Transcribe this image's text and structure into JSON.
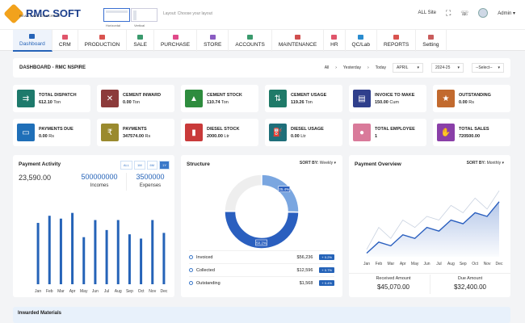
{
  "header": {
    "logo": "RMC SOFT",
    "logo_sub": "READY MIX CONCRETE",
    "layout_options": [
      "Horizontal",
      "Vertical"
    ],
    "layout_hint": "Layout: Choose your layout",
    "site": "ALL Site",
    "user": "Admin"
  },
  "menu": [
    {
      "label": "Dashboard",
      "color": "#2563b8"
    },
    {
      "label": "CRM",
      "color": "#e0556b"
    },
    {
      "label": "PRODUCTION",
      "color": "#d9534f"
    },
    {
      "label": "SALE",
      "color": "#3a9a6d"
    },
    {
      "label": "PURCHASE",
      "color": "#e04a8a"
    },
    {
      "label": "STORE",
      "color": "#8a5cc2"
    },
    {
      "label": "ACCOUNTS",
      "color": "#3a9a6d"
    },
    {
      "label": "MAINTENANCE",
      "color": "#d04f4f"
    },
    {
      "label": "HR",
      "color": "#e0556b"
    },
    {
      "label": "QC/Lab",
      "color": "#2a8ccf"
    },
    {
      "label": "REPORTS",
      "color": "#d9534f"
    },
    {
      "label": "Setting",
      "color": "#c95c5c"
    }
  ],
  "dashboard": {
    "title": "DASHBOARD - RMC NSPIRE",
    "filters": {
      "all": "All",
      "yesterday": "Yesterday",
      "today": "Today",
      "month": "APRIL",
      "year": "2024-25",
      "select": "--Select--"
    }
  },
  "kpis": [
    {
      "title": "TOTAL DISPATCH",
      "value": "612.10",
      "unit": "Ton",
      "color": "#1e7a6c",
      "icon": "truck-icon"
    },
    {
      "title": "CEMENT INWARD",
      "value": "0.00",
      "unit": "Ton",
      "color": "#8c3b3b",
      "icon": "cross-arrows-icon"
    },
    {
      "title": "CEMENT STOCK",
      "value": "110.74",
      "unit": "Ton",
      "color": "#2e8c3e",
      "icon": "stock-chart-icon"
    },
    {
      "title": "CEMENT USAGE",
      "value": "119.26",
      "unit": "Ton",
      "color": "#1f7a68",
      "icon": "updown-arrows-icon"
    },
    {
      "title": "INVOICE TO MAKE",
      "value": "150.00",
      "unit": "Cum",
      "color": "#2f3f8c",
      "icon": "invoice-icon"
    },
    {
      "title": "OUTSTANDING",
      "value": "0.00",
      "unit": "Rs",
      "color": "#c26a2e",
      "icon": "star-box-icon"
    },
    {
      "title": "PAYMENTS DUE",
      "value": "0.00",
      "unit": "Rs",
      "color": "#1f6fb8",
      "icon": "payment-icon"
    },
    {
      "title": "PAYMENTS",
      "value": "347574.00",
      "unit": "Rs",
      "color": "#9a8a2e",
      "icon": "rupee-icon"
    },
    {
      "title": "DIESEL STOCK",
      "value": "2000.00",
      "unit": "Ltr",
      "color": "#c93a3a",
      "icon": "fuel-icon"
    },
    {
      "title": "DIESEL USAGE",
      "value": "0.00",
      "unit": "Ltr",
      "color": "#1f6f7a",
      "icon": "fuel-pump-icon"
    },
    {
      "title": "TOTAL EMPLOYEE",
      "value": "1",
      "unit": "",
      "color": "#d97a9a",
      "icon": "people-icon"
    },
    {
      "title": "TOTAL SALES",
      "value": "720500.00",
      "unit": "",
      "color": "#8a3fa8",
      "icon": "hand-money-icon"
    }
  ],
  "payment_activity": {
    "title": "Payment Activity",
    "buttons": [
      "ALL",
      "1M",
      "6M",
      "1Y"
    ],
    "active": "1Y",
    "total": "23,590.00",
    "incomes_value": "500000000",
    "incomes_label": "Incomes",
    "expenses_value": "3500000",
    "expenses_label": "Expenses"
  },
  "structure": {
    "title": "Structure",
    "sort_label": "SORT BY:",
    "sort_value": "Weekly",
    "rows": [
      {
        "label": "Invoiced",
        "amount": "$56,236",
        "change": "+ 0.2%"
      },
      {
        "label": "Collected",
        "amount": "$12,596",
        "change": "+ 0.7%"
      },
      {
        "label": "Outstanding",
        "amount": "$1,568",
        "change": "+ 0.4%"
      }
    ]
  },
  "payment_overview": {
    "title": "Payment Overview",
    "sort_label": "SORT BY:",
    "sort_value": "Monthly",
    "received_label": "Received Amount",
    "received_value": "$45,070.00",
    "due_label": "Due Amount",
    "due_value": "$32,400.00"
  },
  "inwarded": {
    "title": "Inwarded Materials"
  },
  "chart_data": [
    {
      "type": "bar",
      "categories": [
        "Jan",
        "Feb",
        "Mar",
        "Apr",
        "May",
        "Jun",
        "Jul",
        "Aug",
        "Sep",
        "Oct",
        "Nov",
        "Dec"
      ],
      "values": [
        43,
        48,
        46,
        50,
        33,
        45,
        38,
        45,
        35,
        32,
        45,
        36
      ],
      "ylim": [
        0,
        60
      ],
      "grid": false,
      "color": "#2563b8"
    },
    {
      "type": "pie",
      "style": "donut",
      "slices": [
        {
          "label": "",
          "value": 25
        },
        {
          "label": "25.4%",
          "value": 25.4
        },
        {
          "label": "50.2%",
          "value": 50.2
        }
      ],
      "colors": [
        "#eeeeee",
        "#7aa6e0",
        "#2a5fbf"
      ]
    },
    {
      "type": "area",
      "categories": [
        "Jan",
        "Feb",
        "Mar",
        "Apr",
        "May",
        "Jun",
        "Jul",
        "Aug",
        "Sep",
        "Oct",
        "Nov",
        "Dec"
      ],
      "series": [
        {
          "values": [
            10,
            40,
            25,
            50,
            40,
            55,
            50,
            70,
            60,
            80,
            65,
            90
          ]
        },
        {
          "values": [
            5,
            20,
            15,
            30,
            25,
            40,
            35,
            50,
            45,
            60,
            55,
            75
          ]
        }
      ],
      "ylim": [
        0,
        110
      ],
      "colors": [
        "#c9d2e0",
        "#2a5fbf"
      ]
    }
  ]
}
